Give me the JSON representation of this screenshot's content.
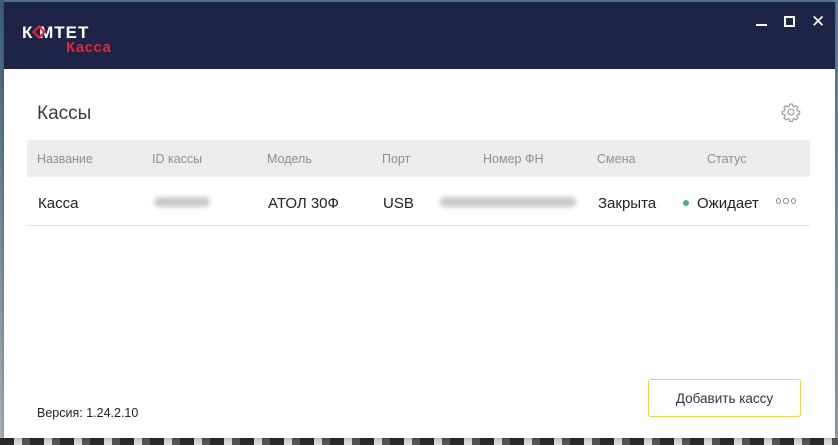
{
  "app": {
    "logo_top": "К   МТЕТ",
    "logo_bottom": "Касса"
  },
  "window_controls": {
    "close_glyph": "✕"
  },
  "page": {
    "title": "Кассы"
  },
  "table": {
    "columns": [
      "Название",
      "ID кассы",
      "Модель",
      "Порт",
      "Номер ФН",
      "Смена",
      "Статус"
    ],
    "rows": [
      {
        "name": "Касса",
        "id": "",
        "model": "АТОЛ 30Ф",
        "port": "USB",
        "fn_number": "",
        "shift": "Закрыта",
        "status": "Ожидает",
        "status_color": "#3cb878"
      }
    ]
  },
  "footer": {
    "version": "Версия:  1.24.2.10",
    "add_button": "Добавить кассу"
  },
  "colors": {
    "titlebar": "#1d2448",
    "brand_red": "#e3262f",
    "button_border": "#f0d24c"
  }
}
